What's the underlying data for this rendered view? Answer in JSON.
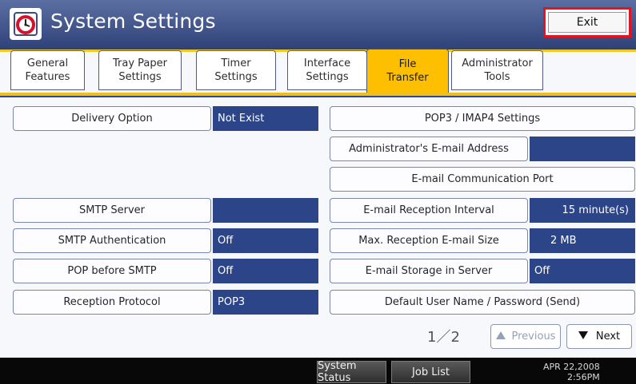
{
  "title": "System Settings",
  "exit_label": "Exit",
  "tabs": [
    {
      "l1": "General",
      "l2": "Features"
    },
    {
      "l1": "Tray Paper",
      "l2": "Settings"
    },
    {
      "l1": "Timer",
      "l2": "Settings"
    },
    {
      "l1": "Interface",
      "l2": "Settings"
    },
    {
      "l1": "File",
      "l2": "Transfer"
    },
    {
      "l1": "Administrator",
      "l2": "Tools"
    }
  ],
  "left": {
    "delivery_option": "Delivery Option",
    "delivery_value": "Not Exist",
    "smtp_server": "SMTP Server",
    "smtp_server_value": "",
    "smtp_auth": "SMTP Authentication",
    "smtp_auth_value": "Off",
    "pop_before_smtp": "POP before SMTP",
    "pop_before_smtp_value": "Off",
    "reception_protocol": "Reception Protocol",
    "reception_protocol_value": "POP3"
  },
  "right": {
    "pop3_settings": "POP3 / IMAP4 Settings",
    "admin_email": "Administrator's E-mail Address",
    "admin_email_value": "",
    "email_port": "E-mail Communication Port",
    "reception_interval": "E-mail Reception Interval",
    "reception_interval_value": "15 minute(s)",
    "max_size": "Max. Reception E-mail Size",
    "max_size_value": "2 MB",
    "storage": "E-mail Storage in Server",
    "storage_value": "Off",
    "default_user": "Default User Name / Password (Send)"
  },
  "pager": {
    "page_indicator": "1／2",
    "previous": "Previous",
    "next": "Next"
  },
  "footer": {
    "system_status": "System Status",
    "job_list": "Job List",
    "date": "APR 22,2008",
    "time": "2:56PM"
  },
  "icons": {
    "app": "clock-icon",
    "prev_arrow": "triangle-up",
    "next_arrow": "triangle-down"
  },
  "colors": {
    "title_blue": "#2f4278",
    "accent_yellow": "#f4c823",
    "value_blue": "#2c4488",
    "exit_highlight": "#e6121d"
  }
}
